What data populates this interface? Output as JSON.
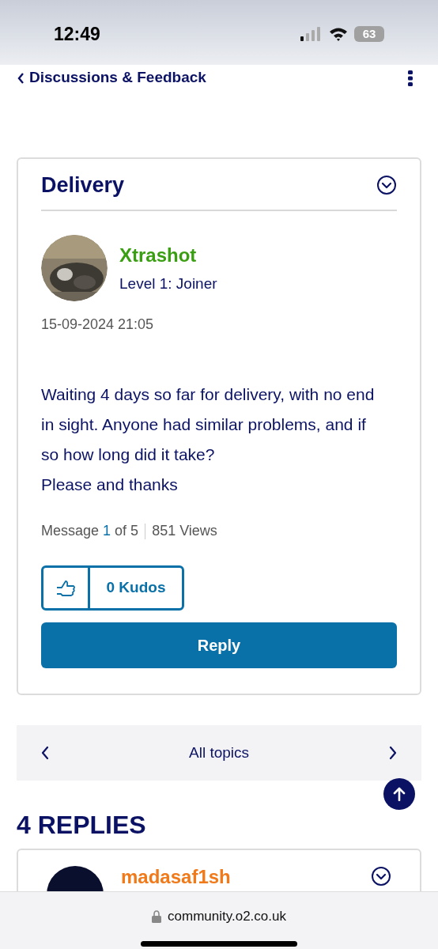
{
  "status_bar": {
    "time": "12:49",
    "battery": "63"
  },
  "nav": {
    "back_label": "Discussions & Feedback"
  },
  "post": {
    "title": "Delivery",
    "author": "Xtrashot",
    "rank": "Level 1: Joiner",
    "date": "15-09-2024 21:05",
    "body": [
      "Waiting 4 days so far for delivery, with no end in sight. Anyone had similar problems, and if so how long did it take?",
      "Please and thanks"
    ],
    "message_prefix": "Message",
    "message_index": "1",
    "message_suffix": "of 5",
    "views": "851 Views",
    "kudos": "0 Kudos",
    "reply_button": "Reply"
  },
  "topics_nav": {
    "label": "All topics"
  },
  "replies_heading": "4 REPLIES",
  "first_reply": {
    "author": "madasaf1sh"
  },
  "browser": {
    "url": "community.o2.co.uk"
  }
}
